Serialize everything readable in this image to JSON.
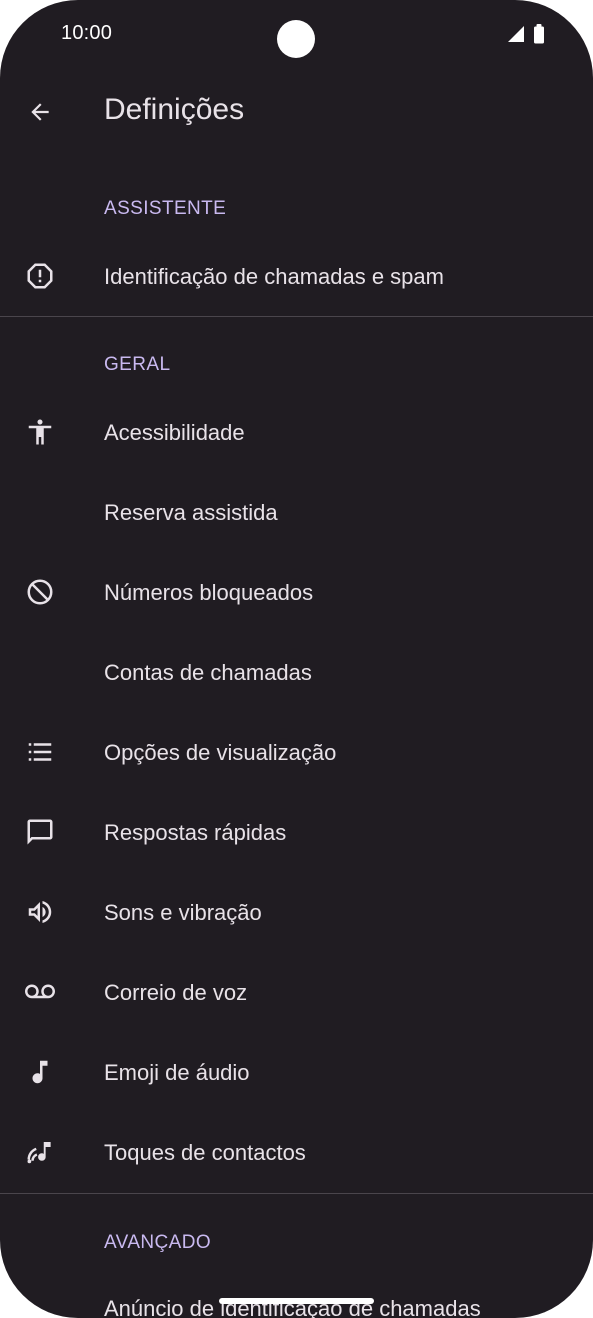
{
  "status_bar": {
    "time": "10:00"
  },
  "app_bar": {
    "title": "Definições"
  },
  "sections": {
    "assistant": {
      "header": "ASSISTENTE",
      "items": [
        {
          "label": "Identificação de chamadas e spam",
          "icon": "info-alert-icon"
        }
      ]
    },
    "general": {
      "header": "GERAL",
      "items": [
        {
          "label": "Acessibilidade",
          "icon": "accessibility-icon"
        },
        {
          "label": "Reserva assistida",
          "icon": ""
        },
        {
          "label": "Números bloqueados",
          "icon": "block-icon"
        },
        {
          "label": "Contas de chamadas",
          "icon": ""
        },
        {
          "label": "Opções de visualização",
          "icon": "list-icon"
        },
        {
          "label": "Respostas rápidas",
          "icon": "message-icon"
        },
        {
          "label": "Sons e vibração",
          "icon": "volume-icon"
        },
        {
          "label": "Correio de voz",
          "icon": "voicemail-icon"
        },
        {
          "label": "Emoji de áudio",
          "icon": "music-note-icon"
        },
        {
          "label": "Toques de contactos",
          "icon": "ringtone-icon"
        }
      ]
    },
    "advanced": {
      "header": "AVANÇADO",
      "items": [
        {
          "label": "Anúncio de identificação de chamadas",
          "icon": ""
        }
      ]
    }
  },
  "colors": {
    "background": "#201c22",
    "text": "#e8e2e8",
    "section_header": "#c9b9f0",
    "divider": "#4a454c"
  }
}
